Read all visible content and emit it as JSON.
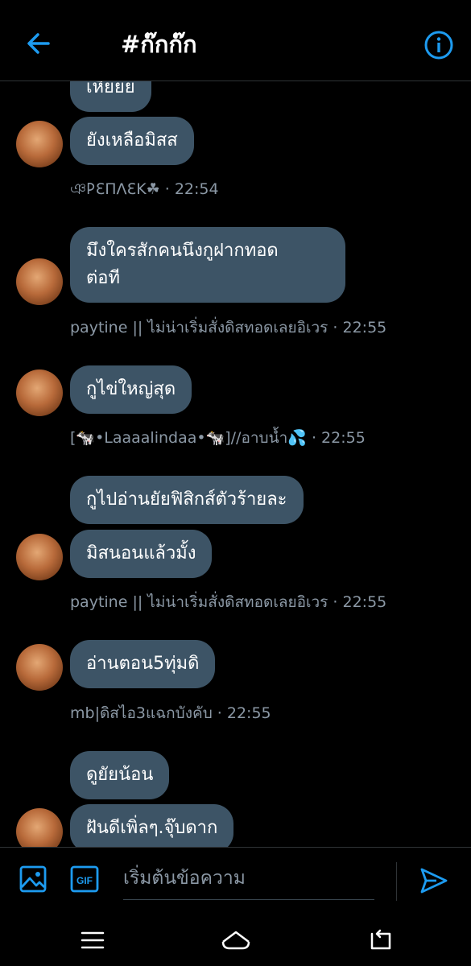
{
  "header": {
    "title": "#ก๊กก๊ก"
  },
  "messages": [
    {
      "text": "เหียยย"
    },
    {
      "text": "ยังเหลือมิสส"
    },
    {
      "meta": "ঞ𐌓ƐΠΛƐK☘ · 22:54"
    },
    {
      "text": "มึงใครสักคนนึงกูฝากทอด",
      "text2": "ต่อที"
    },
    {
      "meta": "paytine || ไม่น่าเริ่มสั่งดิสทอดเลยอิเวร · 22:55"
    },
    {
      "text": "กูไข่ใหญ่สุด"
    },
    {
      "meta": "[🐄•Laaaalindaa•🐄]//อาบน้ำ💦 · 22:55"
    },
    {
      "text": "กูไปอ่านยัยฟิสิกส์ตัวร้ายละ"
    },
    {
      "text": "มิสนอนแล้วมั้ง"
    },
    {
      "meta": "paytine || ไม่น่าเริ่มสั่งดิสทอดเลยอิเวร · 22:55"
    },
    {
      "text": "อ่านตอน5ทุ่มดิ"
    },
    {
      "meta": "mb|ดิสไอ3แฉกบังคับ · 22:55"
    },
    {
      "text": "ดูยัยน้อน"
    },
    {
      "text": "ฝันดีเพิ่ลๆ.จุ๊บดาก"
    }
  ],
  "composer": {
    "placeholder": "เริ่มต้นข้อความ",
    "gif_label": "GIF"
  },
  "colors": {
    "accent": "#1d9bf0",
    "bubble": "#3d5466",
    "meta": "#8b98a5"
  }
}
